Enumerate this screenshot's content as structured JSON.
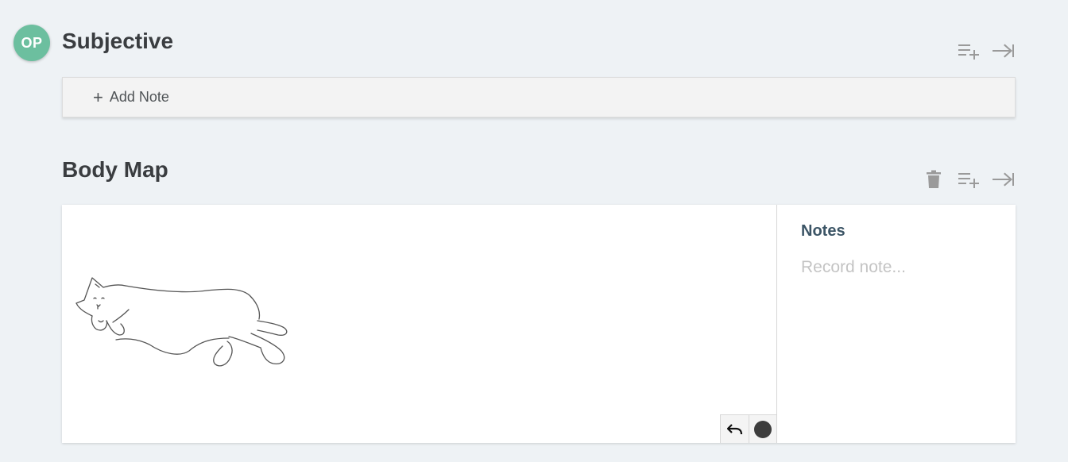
{
  "avatar": {
    "initials": "OP",
    "color": "#6cbf9f"
  },
  "subjective": {
    "title": "Subjective",
    "add_note_label": "Add Note",
    "add_note_icon": "plus-icon",
    "toolbar_icons": [
      "add-list-icon",
      "collapse-right-icon"
    ]
  },
  "body_map": {
    "title": "Body Map",
    "toolbar_icons": [
      "trash-icon",
      "add-list-icon",
      "collapse-right-icon"
    ],
    "drawing": "cat-sketch",
    "controls": {
      "undo_icon": "undo-icon",
      "brush_color": "#3d3d3d"
    },
    "notes": {
      "label": "Notes",
      "placeholder": "Record note...",
      "value": ""
    }
  },
  "colors": {
    "background": "#eef2f5",
    "icon_gray": "#9a9a9a",
    "notes_label": "#3c5566"
  }
}
